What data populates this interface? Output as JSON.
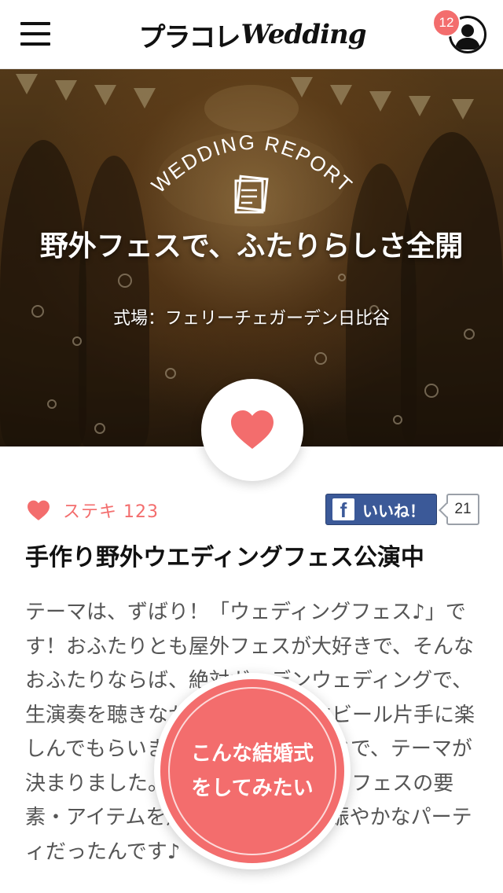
{
  "header": {
    "logo_kana": "プラコレ",
    "logo_latin": "Wedding",
    "notification_count": "12"
  },
  "hero": {
    "report_label": "WEDDING REPORT",
    "title": "野外フェスで、ふたりらしさ全開",
    "venue": "式場：フェリーチェガーデン日比谷"
  },
  "meta": {
    "like_label": "ステキ 123",
    "fb_like_label": "いいね！",
    "fb_count": "21"
  },
  "article": {
    "title": "手作り野外ウエディングフェス公演中",
    "body": "テーマは、ずばり！「ウェディングフェス♪」です！おふたりとも屋外フェスが大好きで、そんなおふたりならば、絶対ガーデンウェディングで、生演奏を聴きながら、みんなで生ビール片手に楽しんでもらいましょう！ということで、テーマが決まりました。いろんなところに、フェスの要素・アイテムを用意してのすごく賑やかなパーティだったんです♪"
  },
  "cta": {
    "label": "こんな結婚式\nをしてみたい"
  },
  "colors": {
    "accent": "#f36d6d",
    "facebook": "#3b5998"
  }
}
